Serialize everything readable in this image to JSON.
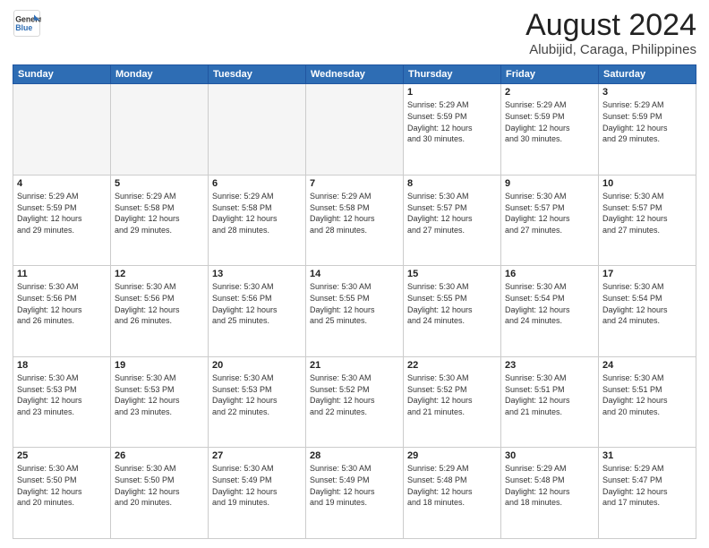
{
  "header": {
    "logo_line1": "General",
    "logo_line2": "Blue",
    "main_title": "August 2024",
    "subtitle": "Alubijid, Caraga, Philippines"
  },
  "weekdays": [
    "Sunday",
    "Monday",
    "Tuesday",
    "Wednesday",
    "Thursday",
    "Friday",
    "Saturday"
  ],
  "weeks": [
    [
      {
        "day": "",
        "info": "",
        "empty": true
      },
      {
        "day": "",
        "info": "",
        "empty": true
      },
      {
        "day": "",
        "info": "",
        "empty": true
      },
      {
        "day": "",
        "info": "",
        "empty": true
      },
      {
        "day": "1",
        "info": "Sunrise: 5:29 AM\nSunset: 5:59 PM\nDaylight: 12 hours\nand 30 minutes."
      },
      {
        "day": "2",
        "info": "Sunrise: 5:29 AM\nSunset: 5:59 PM\nDaylight: 12 hours\nand 30 minutes."
      },
      {
        "day": "3",
        "info": "Sunrise: 5:29 AM\nSunset: 5:59 PM\nDaylight: 12 hours\nand 29 minutes."
      }
    ],
    [
      {
        "day": "4",
        "info": "Sunrise: 5:29 AM\nSunset: 5:59 PM\nDaylight: 12 hours\nand 29 minutes."
      },
      {
        "day": "5",
        "info": "Sunrise: 5:29 AM\nSunset: 5:58 PM\nDaylight: 12 hours\nand 29 minutes."
      },
      {
        "day": "6",
        "info": "Sunrise: 5:29 AM\nSunset: 5:58 PM\nDaylight: 12 hours\nand 28 minutes."
      },
      {
        "day": "7",
        "info": "Sunrise: 5:29 AM\nSunset: 5:58 PM\nDaylight: 12 hours\nand 28 minutes."
      },
      {
        "day": "8",
        "info": "Sunrise: 5:30 AM\nSunset: 5:57 PM\nDaylight: 12 hours\nand 27 minutes."
      },
      {
        "day": "9",
        "info": "Sunrise: 5:30 AM\nSunset: 5:57 PM\nDaylight: 12 hours\nand 27 minutes."
      },
      {
        "day": "10",
        "info": "Sunrise: 5:30 AM\nSunset: 5:57 PM\nDaylight: 12 hours\nand 27 minutes."
      }
    ],
    [
      {
        "day": "11",
        "info": "Sunrise: 5:30 AM\nSunset: 5:56 PM\nDaylight: 12 hours\nand 26 minutes."
      },
      {
        "day": "12",
        "info": "Sunrise: 5:30 AM\nSunset: 5:56 PM\nDaylight: 12 hours\nand 26 minutes."
      },
      {
        "day": "13",
        "info": "Sunrise: 5:30 AM\nSunset: 5:56 PM\nDaylight: 12 hours\nand 25 minutes."
      },
      {
        "day": "14",
        "info": "Sunrise: 5:30 AM\nSunset: 5:55 PM\nDaylight: 12 hours\nand 25 minutes."
      },
      {
        "day": "15",
        "info": "Sunrise: 5:30 AM\nSunset: 5:55 PM\nDaylight: 12 hours\nand 24 minutes."
      },
      {
        "day": "16",
        "info": "Sunrise: 5:30 AM\nSunset: 5:54 PM\nDaylight: 12 hours\nand 24 minutes."
      },
      {
        "day": "17",
        "info": "Sunrise: 5:30 AM\nSunset: 5:54 PM\nDaylight: 12 hours\nand 24 minutes."
      }
    ],
    [
      {
        "day": "18",
        "info": "Sunrise: 5:30 AM\nSunset: 5:53 PM\nDaylight: 12 hours\nand 23 minutes."
      },
      {
        "day": "19",
        "info": "Sunrise: 5:30 AM\nSunset: 5:53 PM\nDaylight: 12 hours\nand 23 minutes."
      },
      {
        "day": "20",
        "info": "Sunrise: 5:30 AM\nSunset: 5:53 PM\nDaylight: 12 hours\nand 22 minutes."
      },
      {
        "day": "21",
        "info": "Sunrise: 5:30 AM\nSunset: 5:52 PM\nDaylight: 12 hours\nand 22 minutes."
      },
      {
        "day": "22",
        "info": "Sunrise: 5:30 AM\nSunset: 5:52 PM\nDaylight: 12 hours\nand 21 minutes."
      },
      {
        "day": "23",
        "info": "Sunrise: 5:30 AM\nSunset: 5:51 PM\nDaylight: 12 hours\nand 21 minutes."
      },
      {
        "day": "24",
        "info": "Sunrise: 5:30 AM\nSunset: 5:51 PM\nDaylight: 12 hours\nand 20 minutes."
      }
    ],
    [
      {
        "day": "25",
        "info": "Sunrise: 5:30 AM\nSunset: 5:50 PM\nDaylight: 12 hours\nand 20 minutes."
      },
      {
        "day": "26",
        "info": "Sunrise: 5:30 AM\nSunset: 5:50 PM\nDaylight: 12 hours\nand 20 minutes."
      },
      {
        "day": "27",
        "info": "Sunrise: 5:30 AM\nSunset: 5:49 PM\nDaylight: 12 hours\nand 19 minutes."
      },
      {
        "day": "28",
        "info": "Sunrise: 5:30 AM\nSunset: 5:49 PM\nDaylight: 12 hours\nand 19 minutes."
      },
      {
        "day": "29",
        "info": "Sunrise: 5:29 AM\nSunset: 5:48 PM\nDaylight: 12 hours\nand 18 minutes."
      },
      {
        "day": "30",
        "info": "Sunrise: 5:29 AM\nSunset: 5:48 PM\nDaylight: 12 hours\nand 18 minutes."
      },
      {
        "day": "31",
        "info": "Sunrise: 5:29 AM\nSunset: 5:47 PM\nDaylight: 12 hours\nand 17 minutes."
      }
    ]
  ]
}
